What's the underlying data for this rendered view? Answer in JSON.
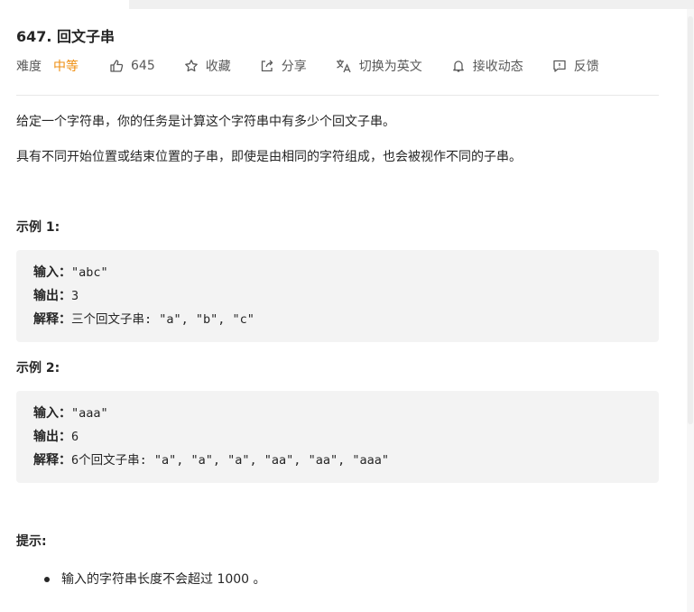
{
  "problem": {
    "title": "647. 回文子串",
    "difficulty_label": "难度",
    "difficulty": "中等",
    "likes": "645",
    "favorite_label": "收藏",
    "share_label": "分享",
    "translate_label": "切换为英文",
    "subscribe_label": "接收动态",
    "feedback_label": "反馈"
  },
  "description": {
    "p1": "给定一个字符串，你的任务是计算这个字符串中有多少个回文子串。",
    "p2": "具有不同开始位置或结束位置的子串，即使是由相同的字符组成，也会被视作不同的子串。"
  },
  "examples": [
    {
      "title": "示例 1:",
      "input_label": "输入：",
      "input": "\"abc\"",
      "output_label": "输出：",
      "output": "3",
      "explain_label": "解释：",
      "explain": "三个回文子串: \"a\", \"b\", \"c\""
    },
    {
      "title": "示例 2:",
      "input_label": "输入：",
      "input": "\"aaa\"",
      "output_label": "输出：",
      "output": "6",
      "explain_label": "解释：",
      "explain": "6个回文子串: \"a\", \"a\", \"a\", \"aa\", \"aa\", \"aaa\""
    }
  ],
  "hint": {
    "title": "提示:",
    "items": [
      "输入的字符串长度不会超过 1000 。"
    ]
  },
  "colors": {
    "difficulty_medium": "#ef8f12",
    "text": "#262626",
    "muted": "#595959",
    "code_bg": "#f3f3f3"
  }
}
